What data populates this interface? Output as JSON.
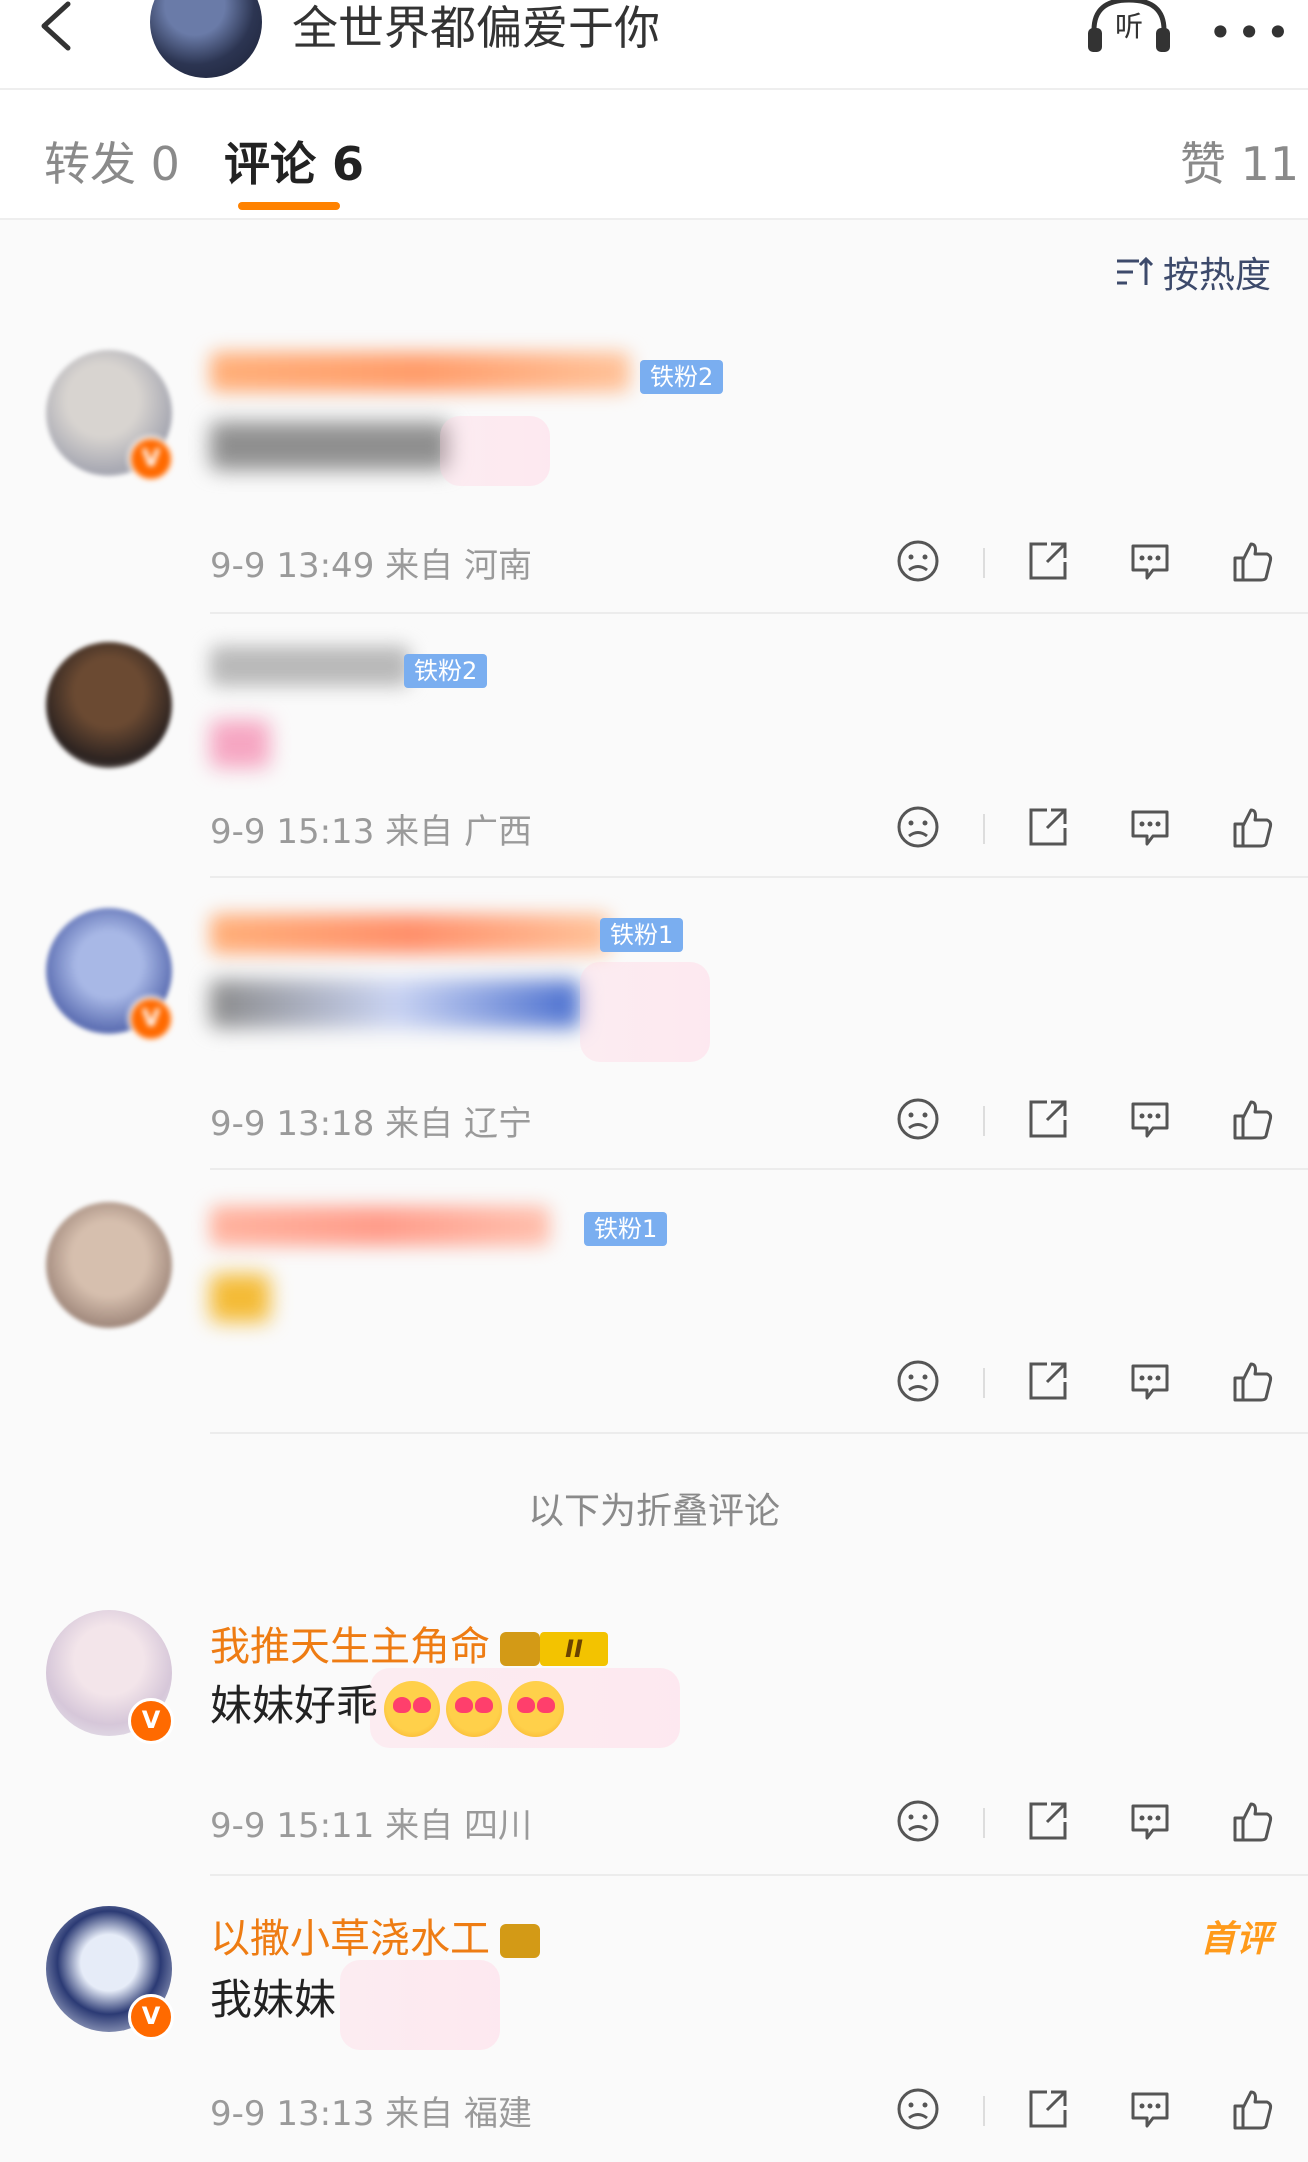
{
  "header": {
    "title": "全世界都偏爱于你",
    "listen_label": "听"
  },
  "tabs": [
    {
      "label": "转发",
      "count": "0"
    },
    {
      "label": "评论",
      "count": "6"
    },
    {
      "label": "赞",
      "count": "11"
    }
  ],
  "sort_label": "按热度",
  "folded_label": "以下为折叠评论",
  "comments": [
    {
      "fan_badge": "铁粉2",
      "time": "9-9 13:49",
      "from": "来自 河南"
    },
    {
      "fan_badge": "铁粉2",
      "time": "9-9 15:13",
      "from": "来自 广西"
    },
    {
      "fan_badge": "铁粉1",
      "time": "9-9 13:18",
      "from": "来自 辽宁"
    },
    {
      "fan_badge": "铁粉1",
      "time": "",
      "from": ""
    },
    {
      "name": "我推天生主角命",
      "level": "II",
      "text": "妹妹好乖",
      "time": "9-9 15:11",
      "from": "来自 四川"
    },
    {
      "name": "以撒小草浇水工",
      "text": "我妹妹",
      "time": "9-9 13:13",
      "from": "来自 福建",
      "tag": "首评"
    }
  ],
  "colors": {
    "accent": "#ff8200",
    "name_orange": "#ee7c13",
    "fan_badge_blue": "#7aaef0",
    "meta_gray": "#9a9a9a"
  }
}
